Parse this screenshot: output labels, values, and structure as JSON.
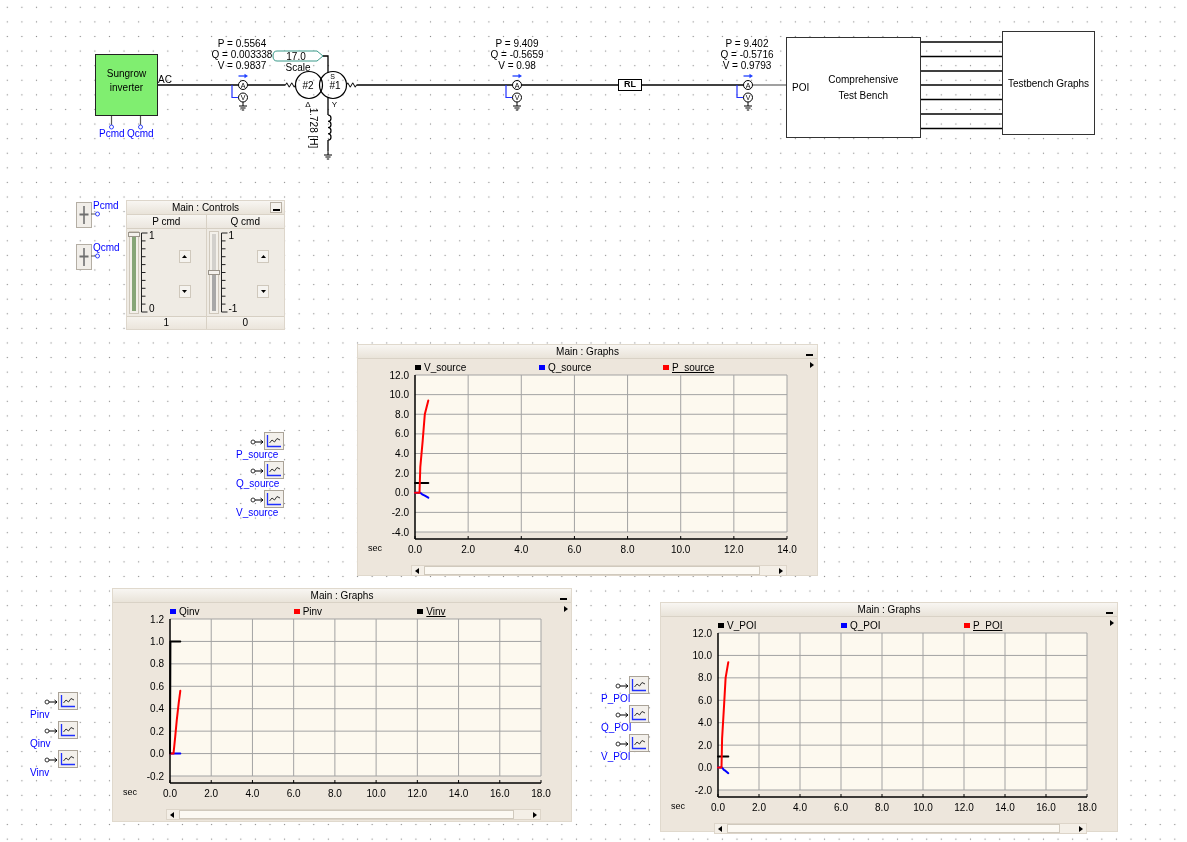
{
  "schematic": {
    "inverter": {
      "label": "Sungrow inverter",
      "output_port": "AC",
      "inputs": [
        "Pcmd",
        "Qcmd"
      ]
    },
    "meters": [
      {
        "readings": [
          "P = 0.5564",
          "Q = 0.003338",
          "V = 0.9837"
        ],
        "current_symbol": "A",
        "voltage_symbol": "V"
      },
      {
        "readings": [
          "P = 9.409",
          "Q = -0.5659",
          "V = 0.98"
        ],
        "current_symbol": "A",
        "voltage_symbol": "V"
      },
      {
        "readings": [
          "P = 9.402",
          "Q = -0.5716",
          "V = 0.9793"
        ],
        "current_symbol": "A",
        "voltage_symbol": "V"
      }
    ],
    "transformer": {
      "tap_value": "17.0",
      "tap_label": "Scale",
      "winding_left": "#2",
      "winding_right": "#1",
      "winding_right_mark": "S",
      "left_connection": "Δ",
      "right_connection": "Y",
      "neutral_inductance": "1.728 [H]"
    },
    "line_impedance": {
      "label": "RL"
    },
    "test_bench": {
      "port": "POI",
      "title": "Comprehensive Test Bench"
    },
    "graphs_block": {
      "label": "Testbench Graphs"
    }
  },
  "sliders": [
    {
      "label": "Pcmd"
    },
    {
      "label": "Qcmd"
    }
  ],
  "controls_panel": {
    "title": "Main : Controls",
    "columns": [
      {
        "label": "P cmd",
        "max": "1",
        "min": "0",
        "value": "1",
        "level": 1,
        "color": "#86a577"
      },
      {
        "label": "Q cmd",
        "max": "1",
        "min": "-1",
        "value": "0",
        "level": 0.5,
        "color": "#a8a8a8"
      }
    ]
  },
  "graph_panels": [
    {
      "title": "Main : Graphs",
      "probes": [
        "P_source",
        "Q_source",
        "V_source"
      ],
      "legend": [
        {
          "selected": false
        },
        {
          "selected": false
        },
        {
          "selected": true
        }
      ],
      "chart_data": {
        "type": "line",
        "xlabel": "sec",
        "grid": true,
        "x": [
          0,
          0.1,
          0.17,
          0.2,
          0.29,
          0.37,
          0.5
        ],
        "series": [
          {
            "name": "V_source",
            "color": "#000000",
            "values": [
              1,
              1,
              1,
              1,
              1,
              1,
              1
            ]
          },
          {
            "name": "Q_source",
            "color": "#0000ff",
            "values": [
              0,
              0,
              0,
              0,
              -0.2,
              -0.3,
              -0.5
            ]
          },
          {
            "name": "P_source",
            "color": "#ff0000",
            "values": [
              0,
              0,
              0,
              2.6,
              5.3,
              8,
              9.4
            ]
          }
        ],
        "xlim": [
          0,
          14
        ],
        "ylim": [
          -4,
          12
        ],
        "xticks": [
          {
            "value": 0,
            "label": "0.0"
          },
          {
            "value": 2,
            "label": "2.0"
          },
          {
            "value": 4,
            "label": "4.0"
          },
          {
            "value": 6,
            "label": "6.0"
          },
          {
            "value": 8,
            "label": "8.0"
          },
          {
            "value": 10,
            "label": "10.0"
          },
          {
            "value": 12,
            "label": "12.0"
          },
          {
            "value": 14,
            "label": "14.0"
          }
        ],
        "yticks": [
          {
            "value": -4,
            "label": "-4.0"
          },
          {
            "value": -2,
            "label": "-2.0"
          },
          {
            "value": 0,
            "label": "0.0"
          },
          {
            "value": 2,
            "label": "2.0"
          },
          {
            "value": 4,
            "label": "4.0"
          },
          {
            "value": 6,
            "label": "6.0"
          },
          {
            "value": 8,
            "label": "8.0"
          },
          {
            "value": 10,
            "label": "10.0"
          },
          {
            "value": 12,
            "label": "12.0"
          }
        ]
      }
    },
    {
      "title": "Main : Graphs",
      "probes": [
        "Pinv",
        "Qinv",
        "Vinv"
      ],
      "legend": [
        {
          "selected": false
        },
        {
          "selected": false
        },
        {
          "selected": true
        }
      ],
      "chart_data": {
        "type": "line",
        "xlabel": "sec",
        "grid": true,
        "x": [
          0,
          0.02,
          0.1,
          0.17,
          0.25,
          0.33,
          0.42,
          0.5
        ],
        "series": [
          {
            "name": "Qinv",
            "color": "#0000ff",
            "values": [
              0,
              0,
              0,
              0,
              0,
              0,
              0,
              0
            ]
          },
          {
            "name": "Pinv",
            "color": "#ff0000",
            "values": [
              0,
              0,
              0,
              0,
              0.15,
              0.3,
              0.45,
              0.56
            ]
          },
          {
            "name": "Vinv",
            "color": "#000000",
            "values": [
              0,
              1,
              1,
              1,
              1,
              1,
              1,
              1
            ]
          }
        ],
        "xlim": [
          0,
          18
        ],
        "ylim": [
          -0.2,
          1.2
        ],
        "xticks": [
          {
            "value": 0,
            "label": "0.0"
          },
          {
            "value": 2,
            "label": "2.0"
          },
          {
            "value": 4,
            "label": "4.0"
          },
          {
            "value": 6,
            "label": "6.0"
          },
          {
            "value": 8,
            "label": "8.0"
          },
          {
            "value": 10,
            "label": "10.0"
          },
          {
            "value": 12,
            "label": "12.0"
          },
          {
            "value": 14,
            "label": "14.0"
          },
          {
            "value": 16,
            "label": "16.0"
          },
          {
            "value": 18,
            "label": "18.0"
          }
        ],
        "yticks": [
          {
            "value": -0.2,
            "label": "-0.2"
          },
          {
            "value": 0,
            "label": "0.0"
          },
          {
            "value": 0.2,
            "label": "0.2"
          },
          {
            "value": 0.4,
            "label": "0.4"
          },
          {
            "value": 0.6,
            "label": "0.6"
          },
          {
            "value": 0.8,
            "label": "0.8"
          },
          {
            "value": 1,
            "label": "1.0"
          },
          {
            "value": 1.2,
            "label": "1.2"
          }
        ]
      }
    },
    {
      "title": "Main : Graphs",
      "probes": [
        "P_POI",
        "Q_POI",
        "V_POI"
      ],
      "legend": [
        {
          "selected": false
        },
        {
          "selected": false
        },
        {
          "selected": true
        }
      ],
      "chart_data": {
        "type": "line",
        "xlabel": "sec",
        "grid": true,
        "x": [
          0,
          0.1,
          0.17,
          0.2,
          0.29,
          0.37,
          0.5
        ],
        "series": [
          {
            "name": "V_POI",
            "color": "#000000",
            "values": [
              1,
              1,
              1,
              1,
              1,
              1,
              1
            ]
          },
          {
            "name": "Q_POI",
            "color": "#0000ff",
            "values": [
              0,
              0,
              0,
              0,
              -0.2,
              -0.3,
              -0.5
            ]
          },
          {
            "name": "P_POI",
            "color": "#ff0000",
            "values": [
              0,
              0,
              0,
              2.6,
              5.3,
              8,
              9.4
            ]
          }
        ],
        "xlim": [
          0,
          18
        ],
        "ylim": [
          -2,
          12
        ],
        "xticks": [
          {
            "value": 0,
            "label": "0.0"
          },
          {
            "value": 2,
            "label": "2.0"
          },
          {
            "value": 4,
            "label": "4.0"
          },
          {
            "value": 6,
            "label": "6.0"
          },
          {
            "value": 8,
            "label": "8.0"
          },
          {
            "value": 10,
            "label": "10.0"
          },
          {
            "value": 12,
            "label": "12.0"
          },
          {
            "value": 14,
            "label": "14.0"
          },
          {
            "value": 16,
            "label": "16.0"
          },
          {
            "value": 18,
            "label": "18.0"
          }
        ],
        "yticks": [
          {
            "value": -2,
            "label": "-2.0"
          },
          {
            "value": 0,
            "label": "0.0"
          },
          {
            "value": 2,
            "label": "2.0"
          },
          {
            "value": 4,
            "label": "4.0"
          },
          {
            "value": 6,
            "label": "6.0"
          },
          {
            "value": 8,
            "label": "8.0"
          },
          {
            "value": 10,
            "label": "10.0"
          },
          {
            "value": 12,
            "label": "12.0"
          }
        ]
      }
    }
  ]
}
